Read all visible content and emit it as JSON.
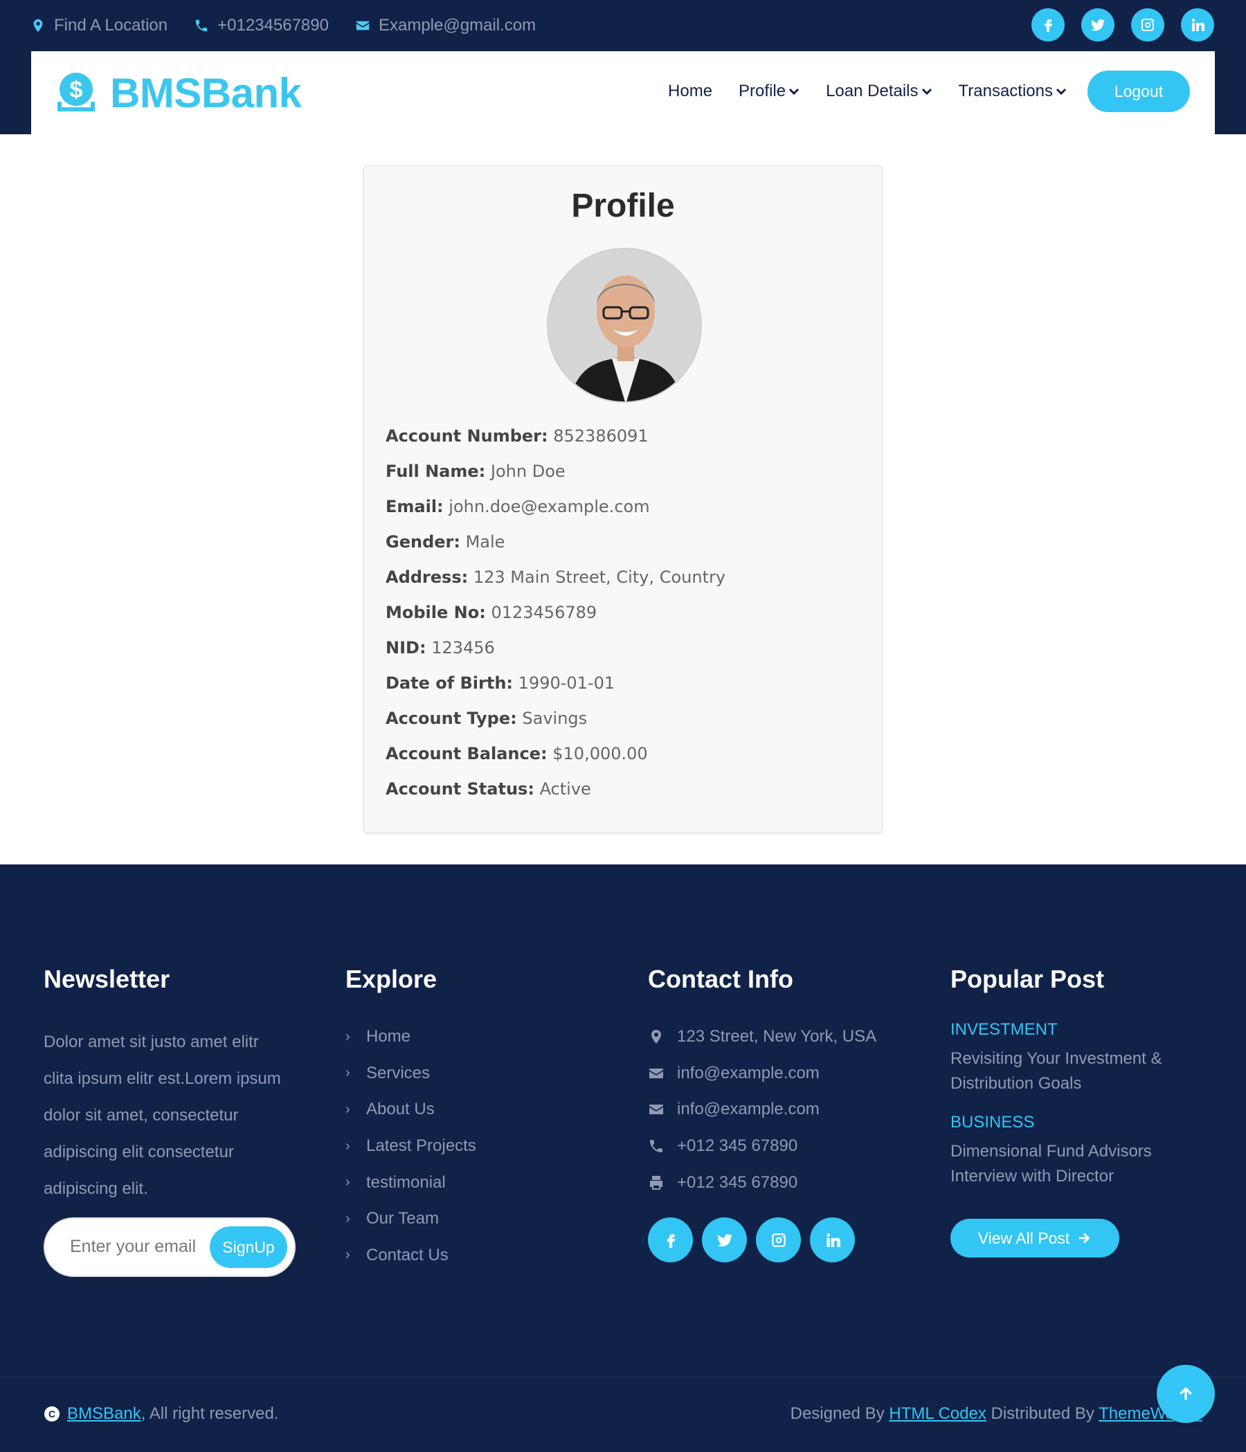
{
  "topbar": {
    "location": "Find A Location",
    "phone": "+01234567890",
    "email": "Example@gmail.com",
    "social": [
      "facebook-icon",
      "twitter-icon",
      "instagram-icon",
      "linkedin-icon"
    ]
  },
  "brand": {
    "name": "BMSBank"
  },
  "nav": {
    "home": "Home",
    "profile": "Profile",
    "loan": "Loan Details",
    "transactions": "Transactions",
    "logout": "Logout"
  },
  "profile": {
    "title": "Profile",
    "fields": [
      {
        "label": "Account Number:",
        "value": "852386091"
      },
      {
        "label": "Full Name:",
        "value": "John Doe"
      },
      {
        "label": "Email:",
        "value": "john.doe@example.com"
      },
      {
        "label": "Gender:",
        "value": "Male"
      },
      {
        "label": "Address:",
        "value": "123 Main Street, City, Country"
      },
      {
        "label": "Mobile No:",
        "value": "0123456789"
      },
      {
        "label": "NID:",
        "value": "123456"
      },
      {
        "label": "Date of Birth:",
        "value": "1990-01-01"
      },
      {
        "label": "Account Type:",
        "value": "Savings"
      },
      {
        "label": "Account Balance:",
        "value": "$10,000.00"
      },
      {
        "label": "Account Status:",
        "value": "Active"
      }
    ]
  },
  "footer": {
    "newsletter": {
      "title": "Newsletter",
      "text": "Dolor amet sit justo amet elitr clita ipsum elitr est.Lorem ipsum dolor sit amet, consectetur adipiscing elit consectetur adipiscing elit.",
      "placeholder": "Enter your email",
      "button": "SignUp"
    },
    "explore": {
      "title": "Explore",
      "links": [
        "Home",
        "Services",
        "About Us",
        "Latest Projects",
        "testimonial",
        "Our Team",
        "Contact Us"
      ]
    },
    "contact": {
      "title": "Contact Info",
      "address": "123 Street, New York, USA",
      "email1": "info@example.com",
      "email2": "info@example.com",
      "phone": "+012 345 67890",
      "fax": "+012 345 67890"
    },
    "posts": {
      "title": "Popular Post",
      "items": [
        {
          "category": "INVESTMENT",
          "title": "Revisiting Your Investment & Distribution Goals"
        },
        {
          "category": "BUSINESS",
          "title": "Dimensional Fund Advisors Interview with Director"
        }
      ],
      "button": "View All Post"
    },
    "copyright": {
      "brand": "BMSBank",
      "text": ", All right reserved."
    },
    "credits": {
      "designed": "Designed By",
      "designer": "HTML Codex",
      "distributed": "Distributed By",
      "distributor": "ThemeWagon"
    }
  },
  "colors": {
    "navy": "#112249",
    "accent": "#33c5f3"
  }
}
